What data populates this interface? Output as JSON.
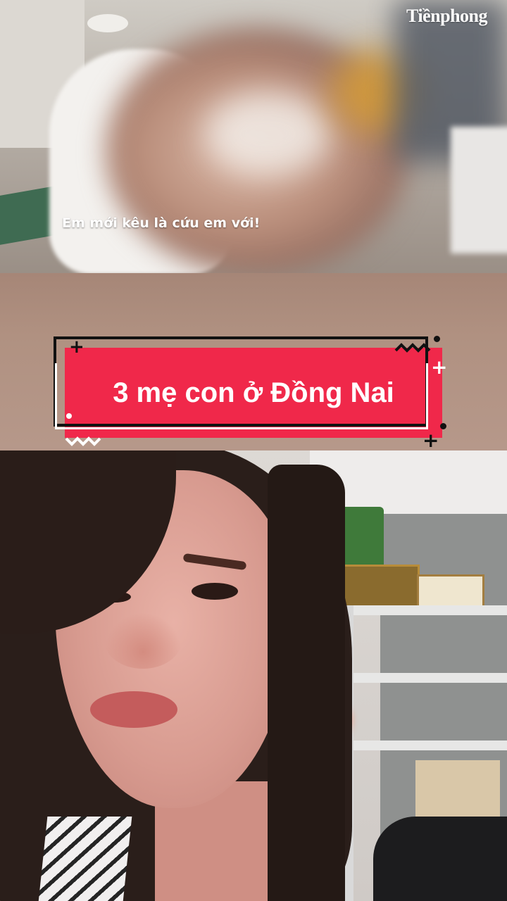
{
  "brand": {
    "logo_text": "Tiềnphong"
  },
  "top_clip": {
    "subtitle": "Em mới kêu là cứu em với!"
  },
  "title_card": {
    "text": "3 mẹ con ở Đồng Nai",
    "fill_color": "#f0284a",
    "outline_color": "#111111"
  },
  "decorations": {
    "plus": "+",
    "zigzag": "⌇"
  }
}
